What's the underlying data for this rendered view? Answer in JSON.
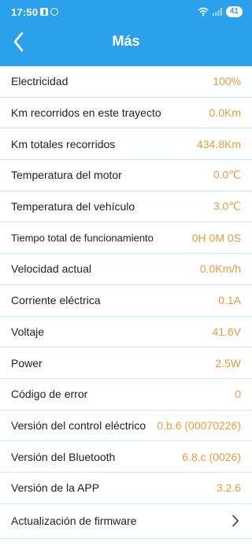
{
  "status_bar": {
    "time": "17:50",
    "battery": "41",
    "icons": [
      "facebook-icon",
      "messenger-icon",
      "wifi-icon",
      "signal-icon"
    ]
  },
  "header": {
    "title": "Más",
    "back_icon": "chevron-left-icon",
    "background_color": "#2aa1ea"
  },
  "colors": {
    "value": "#f39a3a",
    "label": "#222222",
    "divider": "#cfe8f6"
  },
  "rows": [
    {
      "label": "Electricidad",
      "value": "100%"
    },
    {
      "label": "Km recorridos en este trayecto",
      "value": "0.0Km"
    },
    {
      "label": "Km totales recorridos",
      "value": "434.8Km"
    },
    {
      "label": "Temperatura del motor",
      "value": "0.0℃"
    },
    {
      "label": "Temperatura del vehículo",
      "value": "3.0℃"
    },
    {
      "label": "Tiempo total de funcionamiento",
      "value": "0H 0M 0S"
    },
    {
      "label": "Velocidad actual",
      "value": "0.0Km/h"
    },
    {
      "label": "Corriente eléctrica",
      "value": "0.1A"
    },
    {
      "label": "Voltaje",
      "value": "41.6V"
    },
    {
      "label": "Power",
      "value": "2.5W"
    },
    {
      "label": "Código de error",
      "value": "0"
    },
    {
      "label": "Versión del control eléctrico",
      "value": "0.b.6 (00070226)"
    },
    {
      "label": "Versión del Bluetooth",
      "value": "6.8.c (0026)"
    },
    {
      "label": "Versión de la APP",
      "value": "3.2.6"
    }
  ],
  "firmware": {
    "label": "Actualización de firmware",
    "icon": "chevron-right-icon"
  }
}
